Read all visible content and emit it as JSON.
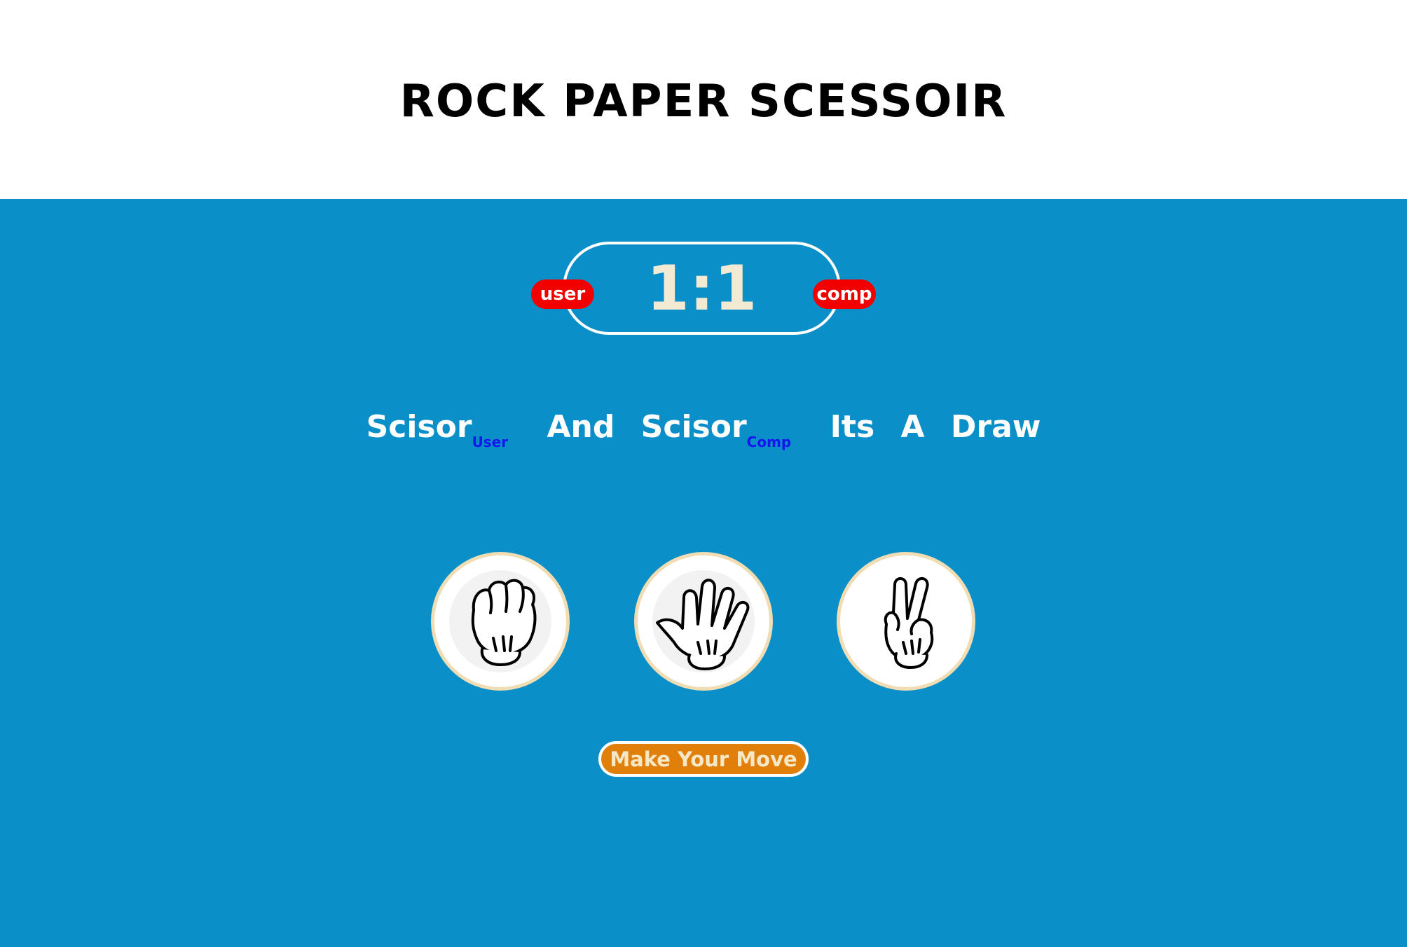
{
  "header": {
    "title": "ROCK PAPER SCESSOIR"
  },
  "scoreboard": {
    "score": "1:1",
    "user_label": "user",
    "comp_label": "comp"
  },
  "result": {
    "user_choice": "Scisor",
    "user_tag": "User",
    "connector": "And",
    "comp_choice": "Scisor",
    "comp_tag": "Comp",
    "outcome": "Its A Draw"
  },
  "choices": [
    {
      "name": "rock",
      "icon": "rock-hand-icon"
    },
    {
      "name": "paper",
      "icon": "paper-hand-icon"
    },
    {
      "name": "scissors",
      "icon": "scissors-hand-icon"
    }
  ],
  "action": {
    "button_label": "Make Your Move"
  },
  "colors": {
    "background": "#0a8fc8",
    "badge": "#f20000",
    "button": "#e07f0a",
    "score_text": "#f3ead4",
    "tag_text": "#1515f0"
  }
}
